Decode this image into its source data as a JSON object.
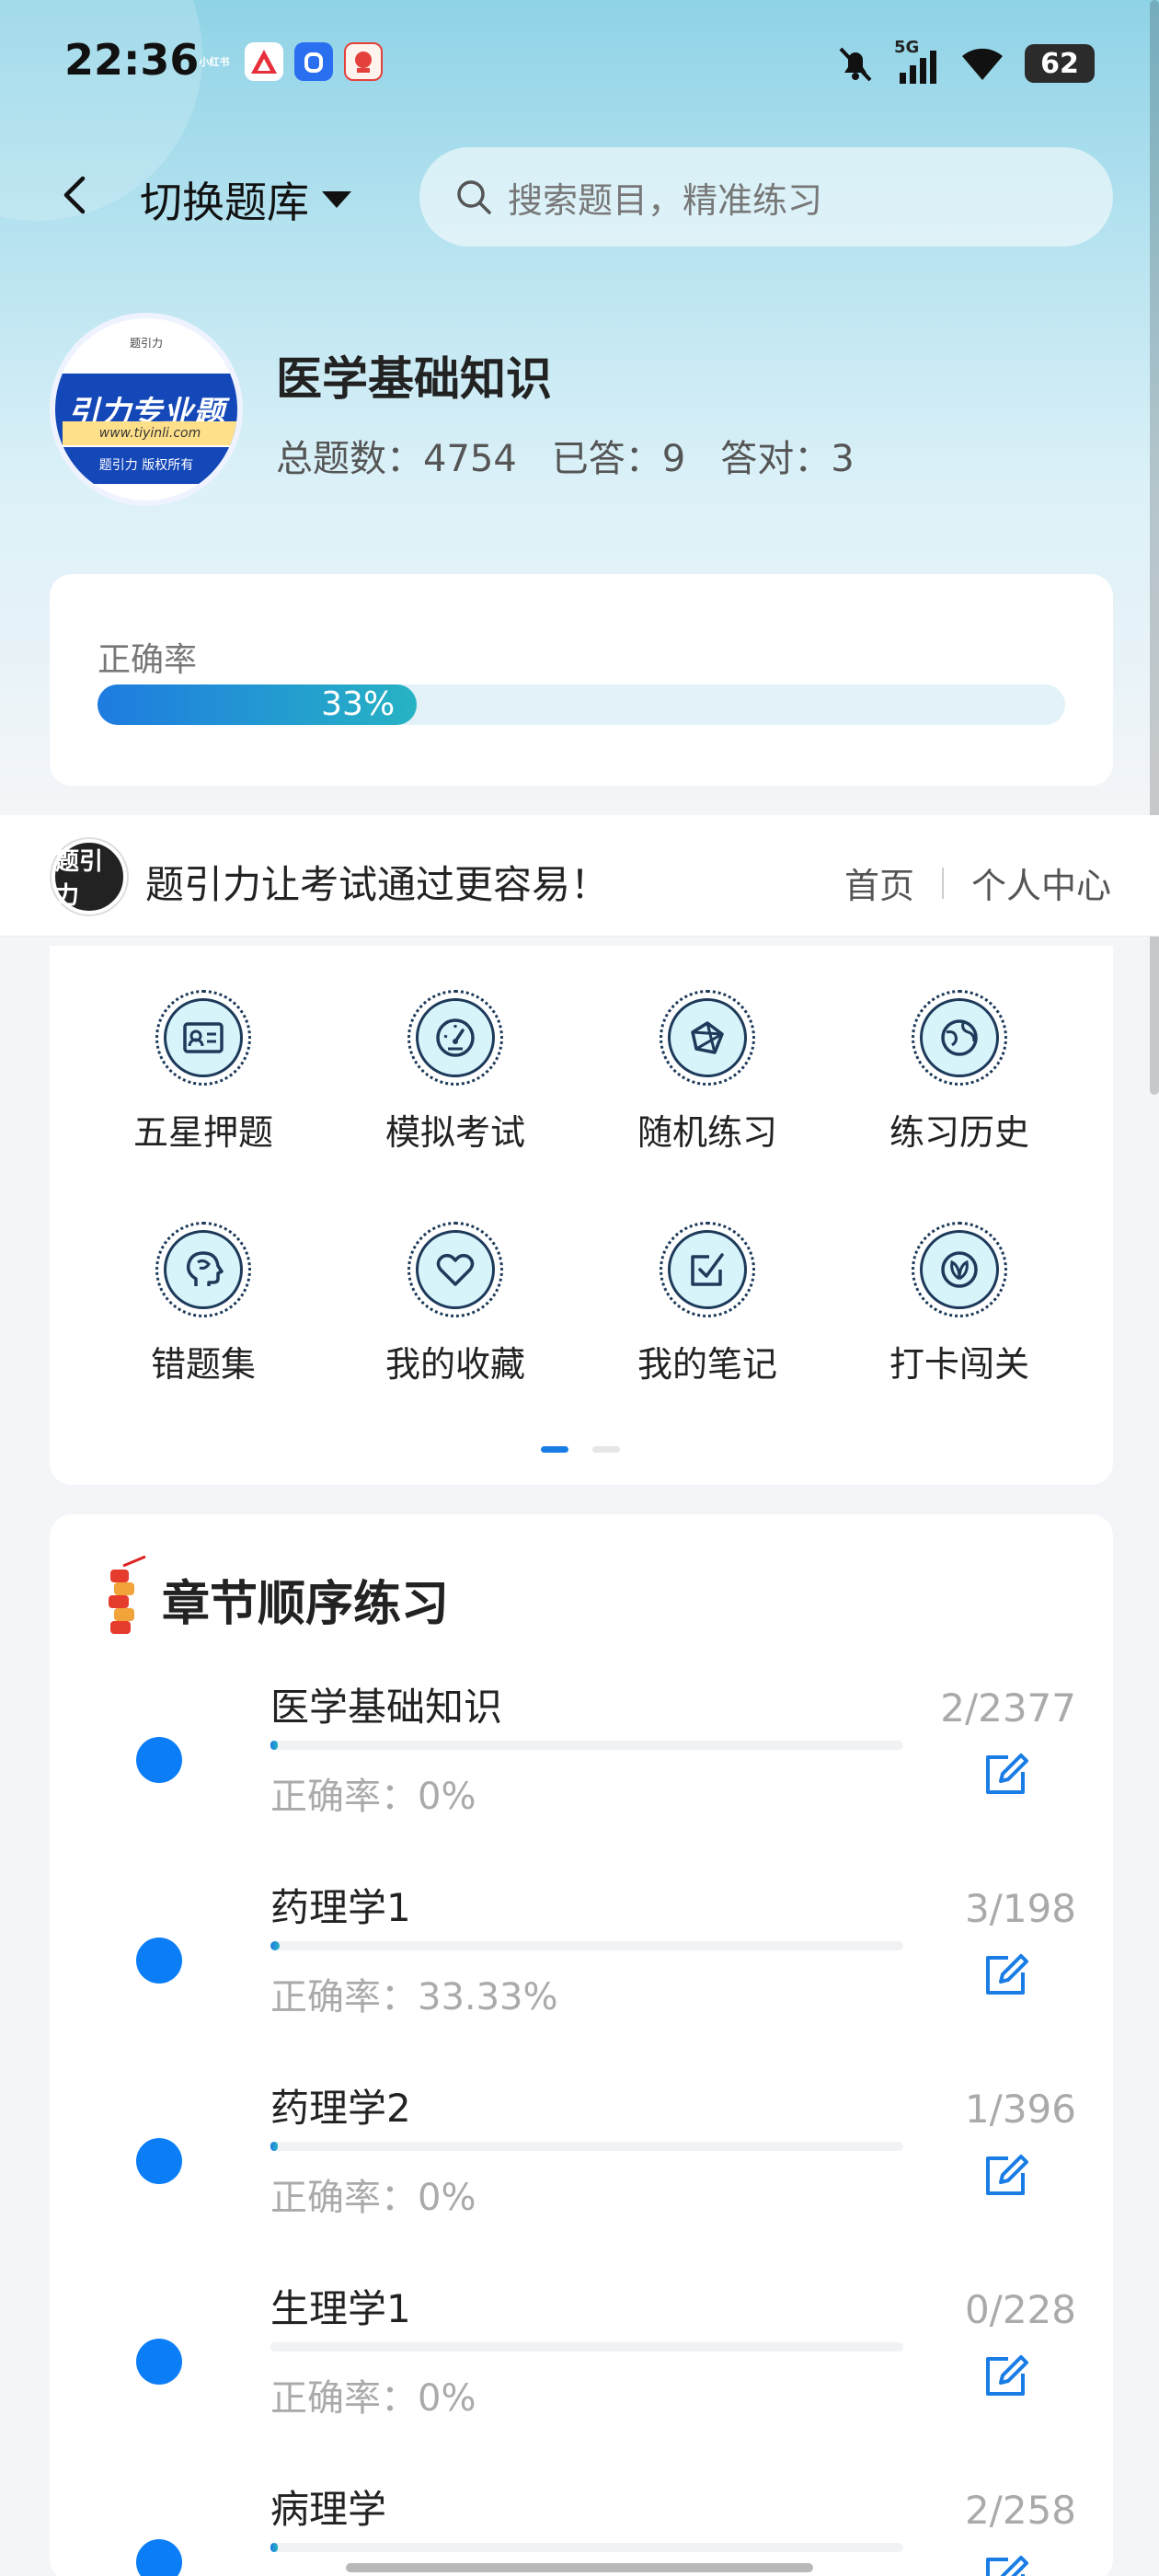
{
  "status_bar": {
    "time": "22:36",
    "apps": [
      {
        "label": "小红书",
        "color": "#e8203c"
      },
      {
        "label": "",
        "color": "#e8303c"
      },
      {
        "label": "",
        "color": "#2a6ff0"
      },
      {
        "label": "",
        "color": "#e4403c"
      }
    ],
    "network": "5G",
    "battery": "62"
  },
  "top_bar": {
    "switch_label": "切换题库",
    "search_placeholder": "搜索题目，精准练习"
  },
  "bank": {
    "logo_top": "题引力",
    "logo_band": "引力专业题",
    "logo_url": "www.tiyinli.com",
    "logo_copyright": "题引力 版权所有",
    "title": "医学基础知识",
    "total": "总题数：4754",
    "answered": "已答：9",
    "correct": "答对：3"
  },
  "accuracy": {
    "label": "正确率",
    "value_text": "33%",
    "value": 0.33
  },
  "banner": {
    "logo_text": "题引力",
    "slogan": "题引力让考试通过更容易！",
    "nav_home": "首页",
    "nav_profile": "个人中心"
  },
  "functions": [
    {
      "label": "五星押题",
      "icon": "id-card-icon"
    },
    {
      "label": "模拟考试",
      "icon": "speedometer-icon"
    },
    {
      "label": "随机练习",
      "icon": "network-icon"
    },
    {
      "label": "练习历史",
      "icon": "globe-icon"
    },
    {
      "label": "错题集",
      "icon": "brain-head-icon"
    },
    {
      "label": "我的收藏",
      "icon": "heart-icon"
    },
    {
      "label": "我的笔记",
      "icon": "note-check-icon"
    },
    {
      "label": "打卡闯关",
      "icon": "leaf-badge-icon"
    }
  ],
  "pager": {
    "pages": 2,
    "active": 0
  },
  "chapters": {
    "title": "章节顺序练习",
    "items": [
      {
        "name": "医学基础知识",
        "accuracy": "正确率：0%",
        "count": "2/2377",
        "progress": 0.0008
      },
      {
        "name": "药理学1",
        "accuracy": "正确率：33.33%",
        "count": "3/198",
        "progress": 0.015
      },
      {
        "name": "药理学2",
        "accuracy": "正确率：0%",
        "count": "1/396",
        "progress": 0.0025
      },
      {
        "name": "生理学1",
        "accuracy": "正确率：0%",
        "count": "0/228",
        "progress": 0
      },
      {
        "name": "病理学",
        "accuracy": "",
        "count": "2/258",
        "progress": 0.008
      }
    ]
  },
  "colors": {
    "accent": "#0a7df7",
    "teal": "#27b3c4",
    "icon_bg": "#d8f4fb",
    "icon_stroke": "#1d3a5a"
  }
}
